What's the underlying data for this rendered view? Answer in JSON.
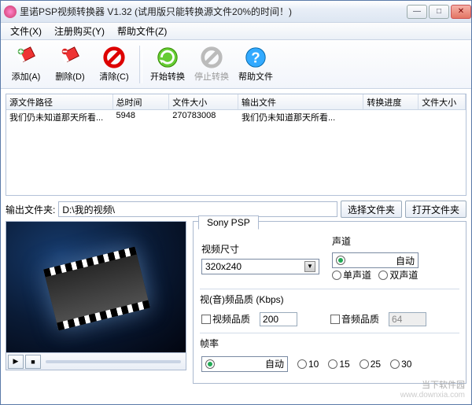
{
  "window": {
    "title": "里诺PSP视频转换器 V1.32 (试用版只能转换源文件20%的时间！)"
  },
  "menus": {
    "file": "文件(X)",
    "register": "注册购买(Y)",
    "help": "帮助文件(Z)"
  },
  "toolbar": {
    "add": "添加(A)",
    "delete": "删除(D)",
    "clear": "清除(C)",
    "start": "开始转换",
    "stop": "停止转换",
    "helpfile": "帮助文件"
  },
  "list": {
    "headers": {
      "src": "源文件路径",
      "duration": "总时间",
      "size": "文件大小",
      "out": "输出文件",
      "progress": "转换进度",
      "outsize": "文件大小"
    },
    "rows": [
      {
        "src": "我们仍未知道那天所看...",
        "duration": "5948",
        "size": "270783008",
        "out": "我们仍未知道那天所看...",
        "progress": "",
        "outsize": ""
      }
    ]
  },
  "output": {
    "label": "输出文件夹:",
    "path": "D:\\我的视频\\",
    "choose": "选择文件夹",
    "open": "打开文件夹"
  },
  "settings": {
    "tab": "Sony PSP",
    "videoSizeLabel": "视频尺寸",
    "videoSizeValue": "320x240",
    "channelLabel": "声道",
    "channelOptions": {
      "auto": "自动",
      "mono": "单声道",
      "stereo": "双声道"
    },
    "qualityLabel": "视(音)频品质 (Kbps)",
    "videoQuality": "视频品质",
    "videoQualityVal": "200",
    "audioQuality": "音频品质",
    "audioQualityVal": "64",
    "fpsLabel": "帧率",
    "fpsOptions": {
      "auto": "自动",
      "f10": "10",
      "f15": "15",
      "f25": "25",
      "f30": "30"
    }
  },
  "watermark": {
    "brand": "当下软件园",
    "url": "www.downxia.com"
  }
}
